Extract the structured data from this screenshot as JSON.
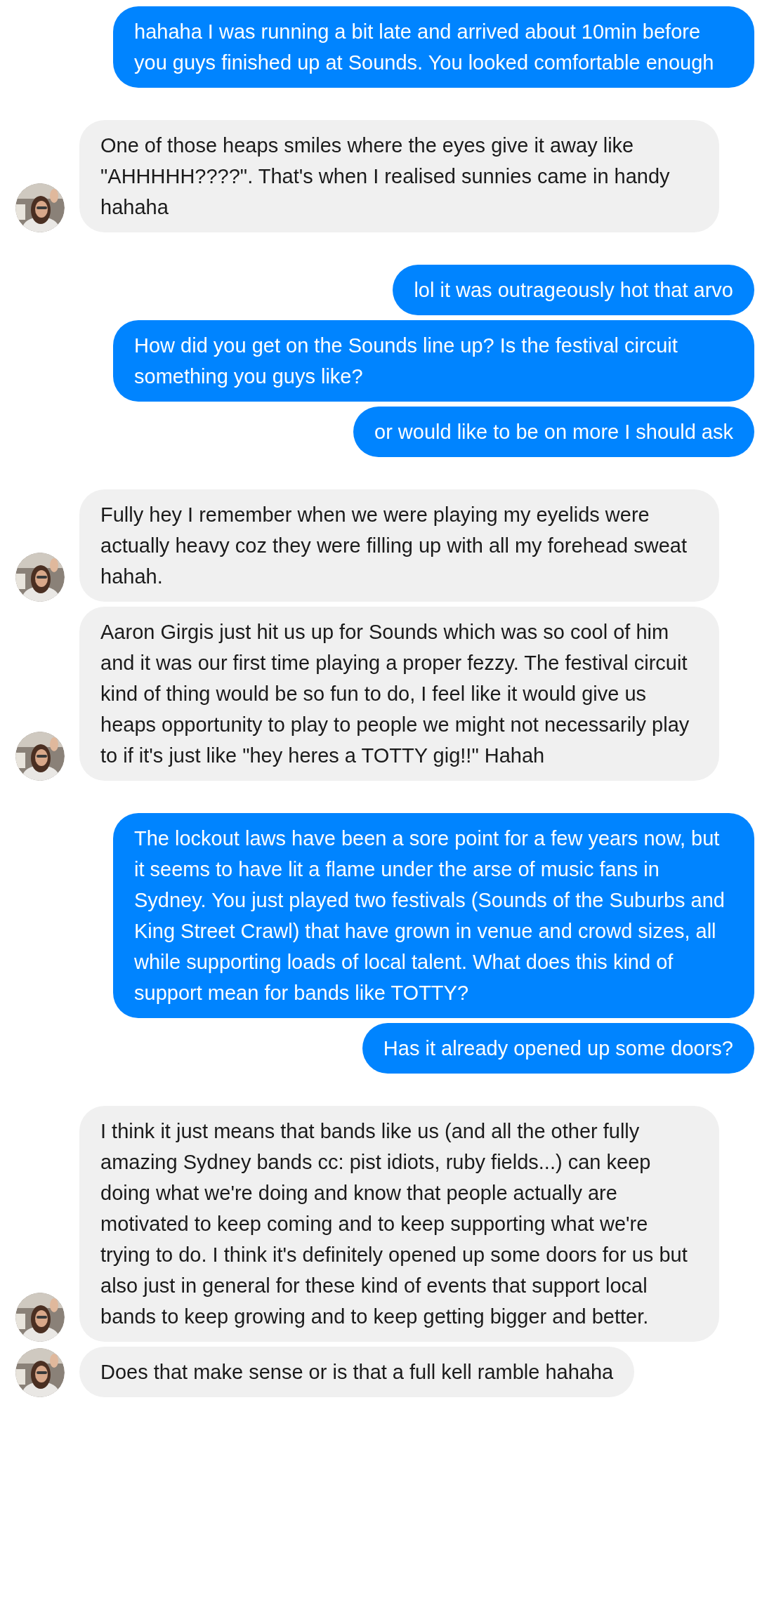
{
  "messages": [
    {
      "kind": "sent",
      "text": "hahaha I was running a bit late and arrived about 10min before you guys finished up at Sounds. You looked comfortable enough"
    },
    {
      "kind": "received",
      "text": "One of those heaps smiles where the eyes give it away like \"AHHHHH????\". That's when I realised sunnies came in handy hahaha"
    },
    {
      "kind": "sent",
      "text": "lol it was outrageously hot that arvo"
    },
    {
      "kind": "sent",
      "text": "How did you get on the Sounds line up? Is the festival circuit something you guys like?"
    },
    {
      "kind": "sent",
      "text": "or would like to be on more I should ask"
    },
    {
      "kind": "received",
      "text": "Fully hey I remember when we were playing my eyelids were actually heavy coz they were filling up with all my forehead sweat hahah."
    },
    {
      "kind": "received",
      "text": "Aaron Girgis just hit us up for Sounds which was so cool of him and it was our first time playing a proper fezzy. The festival circuit kind of thing would be so fun to do, I feel like it would give us heaps opportunity to play to people we might not necessarily play to if it's just like \"hey heres a TOTTY gig!!\" Hahah"
    },
    {
      "kind": "sent",
      "text": "The lockout laws have been a sore point for a few years now, but it seems to have lit a flame under the arse of music fans in Sydney. You just played two festivals (Sounds of the Suburbs and King Street Crawl) that have grown in venue and crowd sizes, all while supporting loads of local talent. What does this kind of support mean for bands like TOTTY?"
    },
    {
      "kind": "sent",
      "text": "Has it already opened up some doors?"
    },
    {
      "kind": "received",
      "text": "I think it just means that bands like us (and all the other fully amazing Sydney bands cc: pist idiots, ruby fields...) can keep doing what we're doing and know that people actually are motivated to keep coming and to keep supporting what we're trying to do. I think it's definitely opened up some doors for us but also just in general for these kind of events that support local bands to keep growing and to keep getting bigger and better."
    },
    {
      "kind": "received",
      "text": "Does that make sense or is that a full kell ramble hahaha"
    }
  ]
}
